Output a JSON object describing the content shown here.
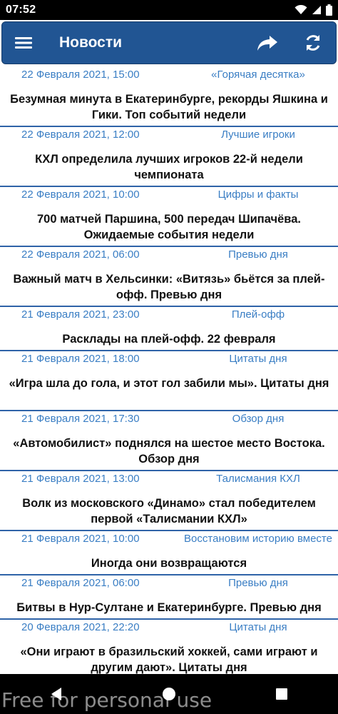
{
  "status": {
    "time": "07:52"
  },
  "appbar": {
    "title": "Новости"
  },
  "news": [
    {
      "date": "22 Февраля 2021, 15:00",
      "category": "«Горячая десятка»",
      "title": "Безумная минута в Екатеринбурге, рекорды Яшкина и Гики. Топ событий недели"
    },
    {
      "date": "22 Февраля 2021, 12:00",
      "category": "Лучшие игроки",
      "title": "КХЛ определила лучших игроков 22-й недели чемпионата"
    },
    {
      "date": "22 Февраля 2021, 10:00",
      "category": "Цифры и факты",
      "title": "700 матчей Паршина, 500 передач Шипачёва. Ожидаемые события недели"
    },
    {
      "date": "22 Февраля 2021, 06:00",
      "category": "Превью дня",
      "title": "Важный матч в Хельсинки: «Витязь» бьётся за плей-офф. Превью дня"
    },
    {
      "date": "21 Февраля 2021, 23:00",
      "category": "Плей-офф",
      "title": "Расклады на плей-офф. 22 февраля"
    },
    {
      "date": "21 Февраля 2021, 18:00",
      "category": "Цитаты дня",
      "title": "«Игра шла до гола, и этот гол забили мы». Цитаты дня"
    },
    {
      "date": "21 Февраля 2021, 17:30",
      "category": "Обзор дня",
      "title": "«Автомобилист» поднялся на шестое место Востока. Обзор дня"
    },
    {
      "date": "21 Февраля 2021, 13:00",
      "category": "Талисмания КХЛ",
      "title": "Волк из московского «Динамо» стал победителем первой «Талисмании КХЛ»"
    },
    {
      "date": "21 Февраля 2021, 10:00",
      "category": "Восстановим историю вместе",
      "title": "Иногда они возвращаются"
    },
    {
      "date": "21 Февраля 2021, 06:00",
      "category": "Превью дня",
      "title": "Битвы в Нур-Султане и Екатеринбурге. Превью дня"
    },
    {
      "date": "20 Февраля 2021, 22:20",
      "category": "Цитаты дня",
      "title": "«Они играют в бразильский хоккей, сами играют и другим дают». Цитаты дня"
    }
  ],
  "watermark": "Free for personal use"
}
